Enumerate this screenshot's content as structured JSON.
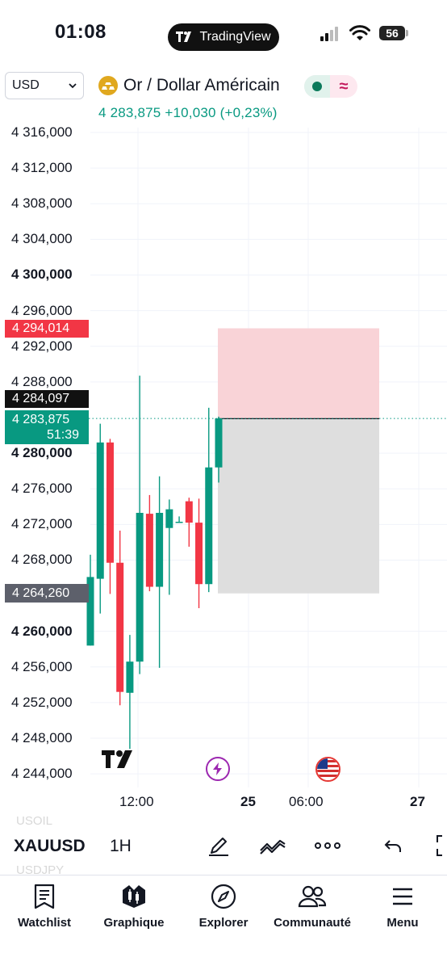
{
  "status_bar": {
    "time": "01:08",
    "app_pill": "TradingView",
    "battery": "56"
  },
  "header": {
    "currency": "USD",
    "symbol_name": "Or / Dollar Américain",
    "quote": "4 283,875  +10,030 (+0,23%)"
  },
  "price_axis": {
    "ticks": [
      {
        "label": "4 316,000",
        "value": 4316,
        "bold": false
      },
      {
        "label": "4 312,000",
        "value": 4312,
        "bold": false
      },
      {
        "label": "4 308,000",
        "value": 4308,
        "bold": false
      },
      {
        "label": "4 304,000",
        "value": 4304,
        "bold": false
      },
      {
        "label": "4 300,000",
        "value": 4300,
        "bold": true
      },
      {
        "label": "4 296,000",
        "value": 4296,
        "bold": false
      },
      {
        "label": "4 292,000",
        "value": 4292,
        "bold": false
      },
      {
        "label": "4 288,000",
        "value": 4288,
        "bold": false
      },
      {
        "label": "4 280,000",
        "value": 4280,
        "bold": true
      },
      {
        "label": "4 276,000",
        "value": 4276,
        "bold": false
      },
      {
        "label": "4 272,000",
        "value": 4272,
        "bold": false
      },
      {
        "label": "4 268,000",
        "value": 4268,
        "bold": false
      },
      {
        "label": "4 260,000",
        "value": 4260,
        "bold": true
      },
      {
        "label": "4 256,000",
        "value": 4256,
        "bold": false
      },
      {
        "label": "4 252,000",
        "value": 4252,
        "bold": false
      },
      {
        "label": "4 248,000",
        "value": 4248,
        "bold": false
      },
      {
        "label": "4 244,000",
        "value": 4244,
        "bold": false
      }
    ],
    "label_stop_loss": "4 294,014",
    "label_high": "4 284,097",
    "label_last": "4 283,875",
    "label_countdown": "51:39",
    "label_take_profit": "4 264,260"
  },
  "time_axis": {
    "ticks": [
      {
        "label": "12:00",
        "bold": false
      },
      {
        "label": "25",
        "bold": true
      },
      {
        "label": "06:00",
        "bold": false
      },
      {
        "label": "27",
        "bold": true
      }
    ]
  },
  "chart_data": {
    "type": "candlestick",
    "interval": "1H",
    "symbol": "XAUUSD",
    "colors": {
      "up": "#089981",
      "down": "#f23645"
    },
    "candles": [
      {
        "o": 4258.4,
        "h": 4268.6,
        "l": 4258.4,
        "c": 4266.1
      },
      {
        "o": 4265.9,
        "h": 4283.3,
        "l": 4262.0,
        "c": 4281.2
      },
      {
        "o": 4281.2,
        "h": 4281.6,
        "l": 4264.2,
        "c": 4267.7
      },
      {
        "o": 4267.7,
        "h": 4271.3,
        "l": 4251.7,
        "c": 4253.2
      },
      {
        "o": 4253.1,
        "h": 4259.6,
        "l": 4246.8,
        "c": 4256.6
      },
      {
        "o": 4256.6,
        "h": 4288.7,
        "l": 4255.2,
        "c": 4273.3
      },
      {
        "o": 4273.2,
        "h": 4275.3,
        "l": 4264.5,
        "c": 4265.0
      },
      {
        "o": 4265.0,
        "h": 4277.4,
        "l": 4255.9,
        "c": 4273.3
      },
      {
        "o": 4271.6,
        "h": 4274.8,
        "l": 4264.1,
        "c": 4273.7
      },
      {
        "o": 4272.3,
        "h": 4272.9,
        "l": 4272.3,
        "c": 4272.3
      },
      {
        "o": 4274.6,
        "h": 4275.0,
        "l": 4269.5,
        "c": 4272.2
      },
      {
        "o": 4272.2,
        "h": 4274.9,
        "l": 4262.6,
        "c": 4265.3
      },
      {
        "o": 4265.3,
        "h": 4285.1,
        "l": 4264.4,
        "c": 4278.4
      },
      {
        "o": 4278.4,
        "h": 4284.1,
        "l": 4276.7,
        "c": 4283.9
      }
    ],
    "position": {
      "type": "short",
      "entry": 4283.875,
      "stop": 4294.014,
      "target": 4264.26
    },
    "ylim": [
      4242.5,
      4318.5
    ],
    "x_ticks": [
      "12:00",
      "25",
      "06:00",
      "27"
    ],
    "grid": true
  },
  "toolbar": {
    "symbol": "XAUUSD",
    "interval": "1H",
    "ghost_above": "USOIL",
    "ghost_below": "USDJPY",
    "icons": [
      "pen-icon",
      "indicators-icon",
      "more-icon",
      "undo-icon",
      "fullscreen-icon"
    ]
  },
  "bottom_nav": {
    "items": [
      {
        "label": "Watchlist",
        "icon": "watchlist-icon"
      },
      {
        "label": "Graphique",
        "icon": "chart-icon"
      },
      {
        "label": "Explorer",
        "icon": "compass-icon"
      },
      {
        "label": "Communauté",
        "icon": "community-icon"
      },
      {
        "label": "Menu",
        "icon": "menu-icon"
      }
    ]
  }
}
